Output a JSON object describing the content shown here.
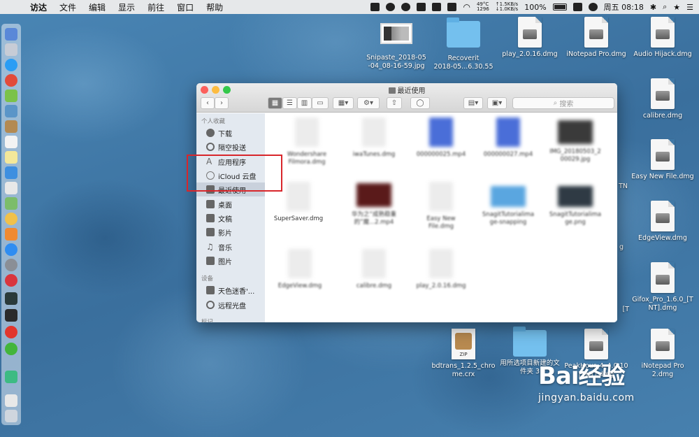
{
  "menubar": {
    "items": [
      "访达",
      "文件",
      "编辑",
      "显示",
      "前往",
      "窗口",
      "帮助"
    ],
    "temperature": "49°C",
    "fan": "1296",
    "net_up": "↑1.5KB/s",
    "net_down": "↓1.0KB/s",
    "battery": "100%",
    "clock": "周五 08:18"
  },
  "desktop": {
    "icons": [
      {
        "label": "Snipaste_2018-05\n-04_08-16-59.jpg",
        "kind": "screenshot"
      },
      {
        "label": "Recoverit\n2018-05...6.30.55",
        "kind": "folder"
      },
      {
        "label": "play_2.0.16.dmg",
        "kind": "dmg"
      },
      {
        "label": "iNotepad Pro.dmg",
        "kind": "dmg"
      },
      {
        "label": "Audio Hijack.dmg",
        "kind": "dmg"
      },
      {
        "label": "calibre.dmg",
        "kind": "dmg"
      },
      {
        "label": "Easy New File.dmg",
        "kind": "dmg"
      },
      {
        "label": "EdgeView.dmg",
        "kind": "dmg"
      },
      {
        "label": "Gifox_Pro_1.6.0_[T\nNT].dmg",
        "kind": "dmg"
      },
      {
        "label": "bdtrans_1.2.5_chro\nme.crx",
        "kind": "zip"
      },
      {
        "label": "用所选项目新建的文\n件夹 3",
        "kind": "folder"
      },
      {
        "label": "PeakHour_4_4.0.10\n[TNT].dmg",
        "kind": "dmg"
      },
      {
        "label": "iNotepad Pro\n2.dmg",
        "kind": "dmg"
      }
    ],
    "partial_labels": [
      "TN",
      "g",
      "[T"
    ]
  },
  "finder": {
    "title": "最近使用",
    "search_placeholder": "搜索",
    "sidebar": {
      "favorites_header": "个人收藏",
      "favorites": [
        {
          "label": "下载",
          "icon": "download-icon"
        },
        {
          "label": "隔空投送",
          "icon": "airdrop-icon"
        },
        {
          "label": "应用程序",
          "icon": "applications-icon"
        },
        {
          "label": "iCloud 云盘",
          "icon": "icloud-icon"
        },
        {
          "label": "最近使用",
          "icon": "recents-icon",
          "selected": true
        },
        {
          "label": "桌面",
          "icon": "desktop-icon"
        },
        {
          "label": "文稿",
          "icon": "documents-icon"
        },
        {
          "label": "影片",
          "icon": "movies-icon"
        },
        {
          "label": "音乐",
          "icon": "music-icon"
        },
        {
          "label": "图片",
          "icon": "pictures-icon"
        }
      ],
      "devices_header": "设备",
      "devices": [
        {
          "label": "天色迷香'...",
          "icon": "computer-icon"
        },
        {
          "label": "远程光盘",
          "icon": "disc-icon"
        }
      ],
      "tags_header": "标记"
    },
    "files": [
      {
        "name": "Wondershare\nFilmora.dmg",
        "thumb": "doc"
      },
      {
        "name": "iwaTunes.dmg",
        "thumb": "doc"
      },
      {
        "name": "000000025.mp4",
        "thumb": "blue"
      },
      {
        "name": "000000027.mp4",
        "thumb": "blue"
      },
      {
        "name": "IMG_20180503_2\n00029.jpg",
        "thumb": "img"
      },
      {
        "name": "SuperSaver.dmg",
        "thumb": "doc"
      },
      {
        "name": "华为之“成熟稳重\n的”魔...2.mp4",
        "thumb": "img"
      },
      {
        "name": "Easy New\nFile.dmg",
        "thumb": "doc"
      },
      {
        "name": "SnagitTutorialima\nge-snapping",
        "thumb": "sky"
      },
      {
        "name": "SnagitTutorialima\nge.png",
        "thumb": "dark"
      },
      {
        "name": "EdgeView.dmg",
        "thumb": "doc"
      },
      {
        "name": "calibre.dmg",
        "thumb": "doc"
      },
      {
        "name": "play_2.0.16.dmg",
        "thumb": "doc"
      }
    ]
  },
  "watermark": {
    "logo": "Bai经验",
    "url": "jingyan.baidu.com"
  }
}
